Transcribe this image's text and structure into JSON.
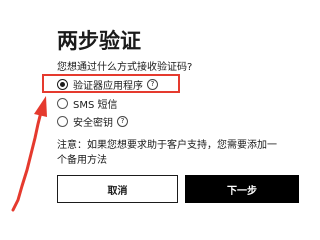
{
  "title": "两步验证",
  "question": "您想通过什么方式接收验证码?",
  "options": [
    {
      "label": "验证器应用程序",
      "selected": true,
      "has_help": true
    },
    {
      "label": "SMS 短信",
      "selected": false,
      "has_help": false
    },
    {
      "label": "安全密钥",
      "selected": false,
      "has_help": true
    }
  ],
  "help_glyph": "?",
  "note": "注意：如果您想要求助于客户支持，您需要添加一个备用方法",
  "buttons": {
    "cancel": "取消",
    "next": "下一步"
  },
  "colors": {
    "annotation": "#e53a2e",
    "primary_button": "#000000"
  }
}
